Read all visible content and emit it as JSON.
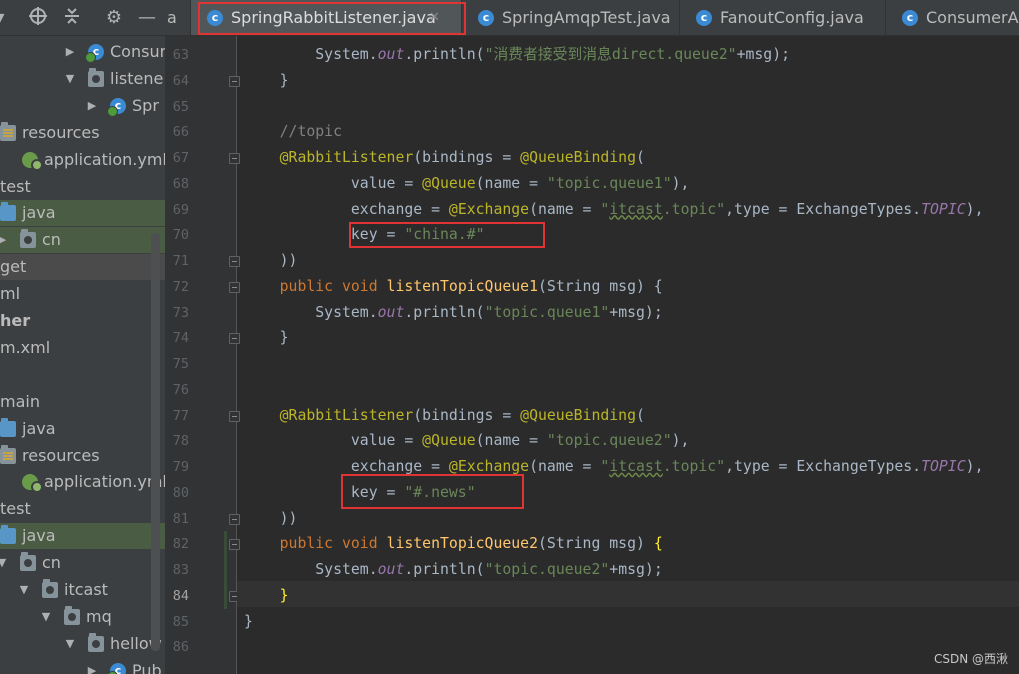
{
  "toolbar": {
    "icons": [
      "collapse-arrow-icon",
      "target-icon",
      "collapse-all-icon",
      "gear-icon",
      "minimize-icon"
    ]
  },
  "tree": [
    {
      "label": "Consur",
      "icon": "class-icon",
      "arrow": "▶",
      "indent": 68
    },
    {
      "label": "listene",
      "icon": "package-folder-icon",
      "arrow": "▼",
      "indent": 68
    },
    {
      "label": "Spr",
      "icon": "class-icon",
      "arrow": "▶",
      "indent": 90
    },
    {
      "label": "resources",
      "icon": "resources-folder-icon",
      "arrow": "",
      "indent": 0
    },
    {
      "label": "application.yml",
      "icon": "spring-config-icon",
      "arrow": "",
      "indent": 22
    },
    {
      "label": "test",
      "icon": "",
      "arrow": "",
      "indent": 0
    },
    {
      "label": "java",
      "icon": "source-folder-icon",
      "arrow": "",
      "indent": 0
    },
    {
      "label": "cn",
      "icon": "package-folder-icon",
      "arrow": "▶",
      "indent": 0
    },
    {
      "label": "get",
      "icon": "",
      "arrow": "",
      "indent": 0
    },
    {
      "label": "ml",
      "icon": "",
      "arrow": "",
      "indent": 0
    },
    {
      "label": "her",
      "icon": "",
      "arrow": "",
      "indent": 0
    },
    {
      "label": "m.xml",
      "icon": "",
      "arrow": "",
      "indent": 0
    },
    {
      "label": "",
      "icon": "",
      "arrow": "",
      "indent": 0
    },
    {
      "label": "main",
      "icon": "",
      "arrow": "",
      "indent": 0
    },
    {
      "label": "java",
      "icon": "source-folder-icon",
      "arrow": "",
      "indent": 0
    },
    {
      "label": "resources",
      "icon": "resources-folder-icon",
      "arrow": "",
      "indent": 0
    },
    {
      "label": "application.yml",
      "icon": "spring-config-icon",
      "arrow": "",
      "indent": 22
    },
    {
      "label": "test",
      "icon": "",
      "arrow": "",
      "indent": 0
    },
    {
      "label": "java",
      "icon": "source-folder-icon",
      "arrow": "",
      "indent": 0
    },
    {
      "label": "cn",
      "icon": "package-folder-icon",
      "arrow": "▼",
      "indent": 0
    },
    {
      "label": "itcast",
      "icon": "package-folder-icon",
      "arrow": "▼",
      "indent": 22
    },
    {
      "label": "mq",
      "icon": "package-folder-icon",
      "arrow": "▼",
      "indent": 44
    },
    {
      "label": "hellow",
      "icon": "package-folder-icon",
      "arrow": "▼",
      "indent": 68
    },
    {
      "label": "Pub",
      "icon": "class-icon",
      "arrow": "▶",
      "indent": 90
    }
  ],
  "tabs": [
    {
      "label": "a",
      "icon": "",
      "active": false,
      "close": false
    },
    {
      "label": "SpringRabbitListener.java",
      "icon": "class-icon",
      "active": true,
      "close": true
    },
    {
      "label": "SpringAmqpTest.java",
      "icon": "test-class-icon",
      "active": false,
      "close": false
    },
    {
      "label": "FanoutConfig.java",
      "icon": "class-icon",
      "active": false,
      "close": false
    },
    {
      "label": "ConsumerApp",
      "icon": "spring-boot-class-icon",
      "active": false,
      "close": false
    }
  ],
  "editor": {
    "current_line": 84,
    "lines": [
      {
        "n": 63,
        "fold": false,
        "segs": [
          [
            "",
            "        System."
          ],
          [
            "t-field",
            "out"
          ],
          [
            "",
            ".println("
          ],
          [
            "t-str",
            "\"消费者接受到消息direct.queue2\""
          ],
          [
            "",
            "+msg);"
          ]
        ]
      },
      {
        "n": 64,
        "fold": true,
        "segs": [
          [
            "",
            "    }"
          ]
        ]
      },
      {
        "n": 65,
        "fold": false,
        "segs": [
          [
            "",
            ""
          ]
        ]
      },
      {
        "n": 66,
        "fold": false,
        "segs": [
          [
            "t-cmt",
            "    //topic"
          ]
        ]
      },
      {
        "n": 67,
        "fold": true,
        "segs": [
          [
            "t-ann",
            "    @RabbitListener"
          ],
          [
            "",
            "(bindings = "
          ],
          [
            "t-ann",
            "@QueueBinding"
          ],
          [
            "",
            "("
          ]
        ]
      },
      {
        "n": 68,
        "fold": false,
        "segs": [
          [
            "",
            "            value = "
          ],
          [
            "t-ann",
            "@Queue"
          ],
          [
            "",
            "(name = "
          ],
          [
            "t-str",
            "\"topic.queue1\""
          ],
          [
            "",
            "),"
          ]
        ]
      },
      {
        "n": 69,
        "fold": false,
        "segs": [
          [
            "",
            "            exchange = "
          ],
          [
            "t-ann",
            "@Exchange"
          ],
          [
            "",
            "(name = "
          ],
          [
            "t-str",
            "\""
          ],
          [
            "t-str t-squig",
            "itcast"
          ],
          [
            "t-str",
            ".topic\""
          ],
          [
            "",
            ",type = ExchangeTypes."
          ],
          [
            "t-const",
            "TOPIC"
          ],
          [
            "",
            "),"
          ]
        ]
      },
      {
        "n": 70,
        "fold": false,
        "segs": [
          [
            "",
            "            key = "
          ],
          [
            "t-str",
            "\"china.#\""
          ]
        ]
      },
      {
        "n": 71,
        "fold": true,
        "segs": [
          [
            "",
            "    ))"
          ]
        ]
      },
      {
        "n": 72,
        "fold": true,
        "segs": [
          [
            "t-kw",
            "    public void "
          ],
          [
            "t-fn",
            "listenTopicQueue1"
          ],
          [
            "",
            "(String msg) {"
          ]
        ]
      },
      {
        "n": 73,
        "fold": false,
        "segs": [
          [
            "",
            "        System."
          ],
          [
            "t-field",
            "out"
          ],
          [
            "",
            ".println("
          ],
          [
            "t-str",
            "\"topic.queue1\""
          ],
          [
            "",
            "+msg);"
          ]
        ]
      },
      {
        "n": 74,
        "fold": true,
        "segs": [
          [
            "",
            "    }"
          ]
        ]
      },
      {
        "n": 75,
        "fold": false,
        "segs": [
          [
            "",
            ""
          ]
        ]
      },
      {
        "n": 76,
        "fold": false,
        "segs": [
          [
            "",
            ""
          ]
        ]
      },
      {
        "n": 77,
        "fold": true,
        "segs": [
          [
            "t-ann",
            "    @RabbitListener"
          ],
          [
            "",
            "(bindings = "
          ],
          [
            "t-ann",
            "@QueueBinding"
          ],
          [
            "",
            "("
          ]
        ]
      },
      {
        "n": 78,
        "fold": false,
        "segs": [
          [
            "",
            "            value = "
          ],
          [
            "t-ann",
            "@Queue"
          ],
          [
            "",
            "(name = "
          ],
          [
            "t-str",
            "\"topic.queue2\""
          ],
          [
            "",
            "),"
          ]
        ]
      },
      {
        "n": 79,
        "fold": false,
        "segs": [
          [
            "",
            "            exchange = "
          ],
          [
            "t-ann",
            "@Exchange"
          ],
          [
            "",
            "(name = "
          ],
          [
            "t-str",
            "\""
          ],
          [
            "t-str t-squig",
            "itcast"
          ],
          [
            "t-str",
            ".topic\""
          ],
          [
            "",
            ",type = ExchangeTypes."
          ],
          [
            "t-const",
            "TOPIC"
          ],
          [
            "",
            "),"
          ]
        ]
      },
      {
        "n": 80,
        "fold": false,
        "segs": [
          [
            "",
            "            key = "
          ],
          [
            "t-str",
            "\"#.news\""
          ]
        ]
      },
      {
        "n": 81,
        "fold": true,
        "segs": [
          [
            "",
            "    ))"
          ]
        ]
      },
      {
        "n": 82,
        "fold": true,
        "segs": [
          [
            "t-kw",
            "    public void "
          ],
          [
            "t-fn",
            "listenTopicQueue2"
          ],
          [
            "",
            "(String msg) "
          ],
          [
            "t-brace",
            "{"
          ]
        ]
      },
      {
        "n": 83,
        "fold": false,
        "segs": [
          [
            "",
            "        System."
          ],
          [
            "t-field",
            "out"
          ],
          [
            "",
            ".println("
          ],
          [
            "t-str",
            "\"topic.queue2\""
          ],
          [
            "",
            "+msg);"
          ]
        ]
      },
      {
        "n": 84,
        "fold": true,
        "segs": [
          [
            "t-brace",
            "    }"
          ]
        ]
      },
      {
        "n": 85,
        "fold": false,
        "segs": [
          [
            "",
            "}"
          ]
        ]
      },
      {
        "n": 86,
        "fold": false,
        "segs": [
          [
            "",
            ""
          ]
        ]
      }
    ]
  },
  "watermark": "CSDN @西湫"
}
